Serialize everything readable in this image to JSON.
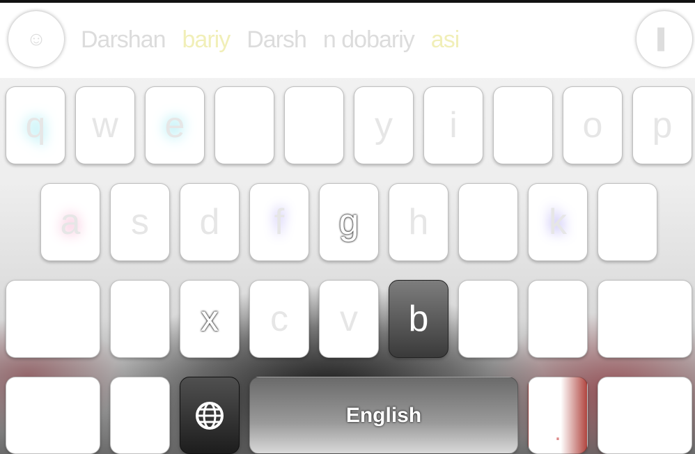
{
  "suggestion_bar": {
    "left_icon": "emoji-icon",
    "right_icon": "mic-icon",
    "suggestions": [
      "Darshan",
      "bariy",
      "Darsh",
      "n dobariy",
      "asi"
    ]
  },
  "rows": {
    "row1": [
      "q",
      "w",
      "e",
      "",
      "",
      "y",
      "i",
      "",
      "o",
      "p"
    ],
    "row2": [
      "a",
      "s",
      "d",
      "f",
      "g",
      "h",
      "",
      "k",
      ""
    ],
    "row3": [
      "",
      "",
      "x",
      "c",
      "v",
      "b",
      "",
      "",
      ""
    ],
    "row4": {
      "globe_icon": "globe-icon",
      "space_label": "English",
      "period_label": "."
    }
  },
  "colors": {
    "background_dark": "#3a3a3a",
    "key_bg": "#ffffff",
    "accent_red": "#b0453f"
  }
}
